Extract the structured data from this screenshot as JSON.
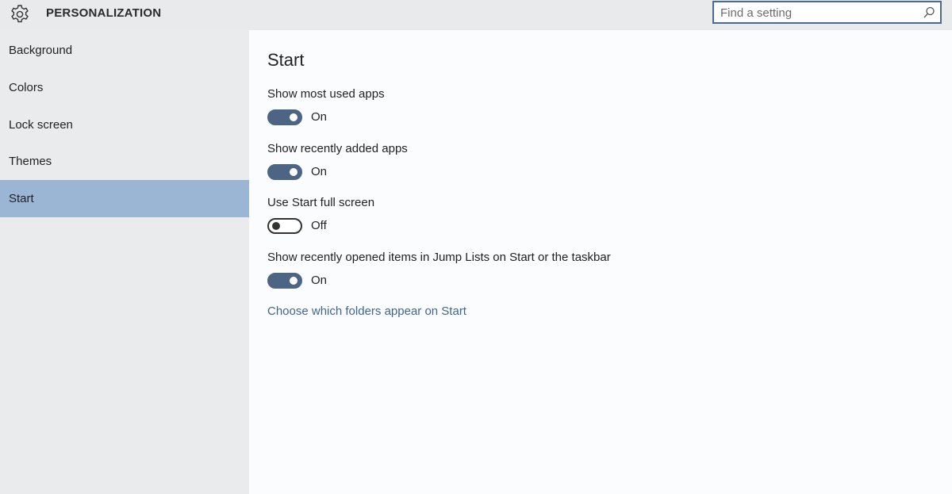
{
  "header": {
    "title": "PERSONALIZATION",
    "search_placeholder": "Find a setting"
  },
  "sidebar": {
    "items": [
      {
        "label": "Background"
      },
      {
        "label": "Colors"
      },
      {
        "label": "Lock screen"
      },
      {
        "label": "Themes"
      },
      {
        "label": "Start",
        "selected": true
      }
    ]
  },
  "main": {
    "title": "Start",
    "settings": [
      {
        "label": "Show most used apps",
        "state": "On"
      },
      {
        "label": "Show recently added apps",
        "state": "On"
      },
      {
        "label": "Use Start full screen",
        "state": "Off"
      },
      {
        "label": "Show recently opened items in Jump Lists on Start or the taskbar",
        "state": "On"
      }
    ],
    "link": "Choose which folders appear on Start"
  },
  "colors": {
    "selected_nav": "#9ab6d4",
    "toggle_on": "#4d6584",
    "link": "#3f6690",
    "search_border": "#4a6a96"
  },
  "icons": {
    "header": "gear-icon",
    "search": "search-icon"
  }
}
